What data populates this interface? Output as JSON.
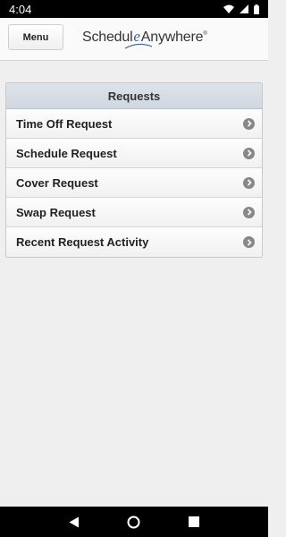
{
  "status_bar": {
    "time": "4:04",
    "icons": [
      "wifi-icon",
      "signal-icon",
      "battery-icon"
    ]
  },
  "header": {
    "menu_label": "Menu",
    "logo": {
      "part1": "Schedul",
      "part2": "e",
      "part3": "Anywhere",
      "reg": "®"
    }
  },
  "requests": {
    "title": "Requests",
    "items": [
      {
        "label": "Time Off Request"
      },
      {
        "label": "Schedule Request"
      },
      {
        "label": "Cover Request"
      },
      {
        "label": "Swap Request"
      },
      {
        "label": "Recent Request Activity"
      }
    ]
  },
  "nav_bar": {
    "buttons": [
      "back-icon",
      "home-icon",
      "recents-icon"
    ]
  },
  "colors": {
    "status_bar": "#000000",
    "header_bg": "#fafafa",
    "panel_header": "#d5dce4",
    "chevron": "#888888",
    "logo_accent": "#3b5f98"
  }
}
